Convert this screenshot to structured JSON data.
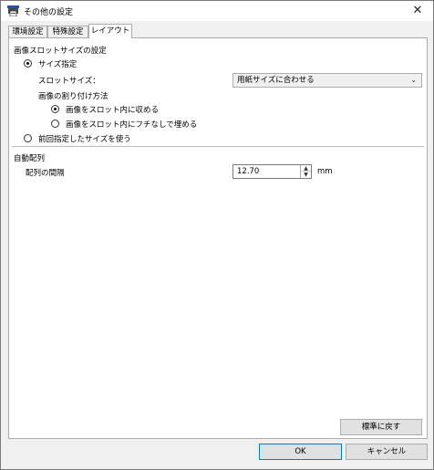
{
  "window": {
    "title": "その他の設定",
    "close_glyph": "✕",
    "app_icon": "printer-settings-icon"
  },
  "tabs": [
    {
      "label": "環境設定",
      "active": false
    },
    {
      "label": "特殊設定",
      "active": false
    },
    {
      "label": "レイアウト",
      "active": true
    }
  ],
  "layout": {
    "slot_size_section_label": "画像スロットサイズの設定",
    "size_specify_label": "サイズ指定",
    "slot_size_label": "スロットサイズ：",
    "slot_size_value": "用紙サイズに合わせる",
    "assign_method_label": "画像の割り付け方法",
    "fit_in_slot_label": "画像をスロット内に収める",
    "fill_slot_label": "画像をスロット内にフチなしで埋める",
    "use_previous_size_label": "前回指定したサイズを使う",
    "auto_arrange_label": "自動配列",
    "spacing_label": "配列の間隔",
    "spacing_value": "12.70",
    "spacing_unit": "mm",
    "reset_button_label": "標準に戻す"
  },
  "footer": {
    "ok_label": "OK",
    "cancel_label": "キャンセル"
  },
  "state": {
    "size_specify_selected": true,
    "fit_in_slot_selected": true,
    "fill_slot_selected": false,
    "use_previous_size_selected": false
  },
  "colors": {
    "panel_background": "#ffffff",
    "window_background": "#f0f0f0",
    "button_face": "#e1e1e1",
    "default_button_border": "#0078d7"
  }
}
